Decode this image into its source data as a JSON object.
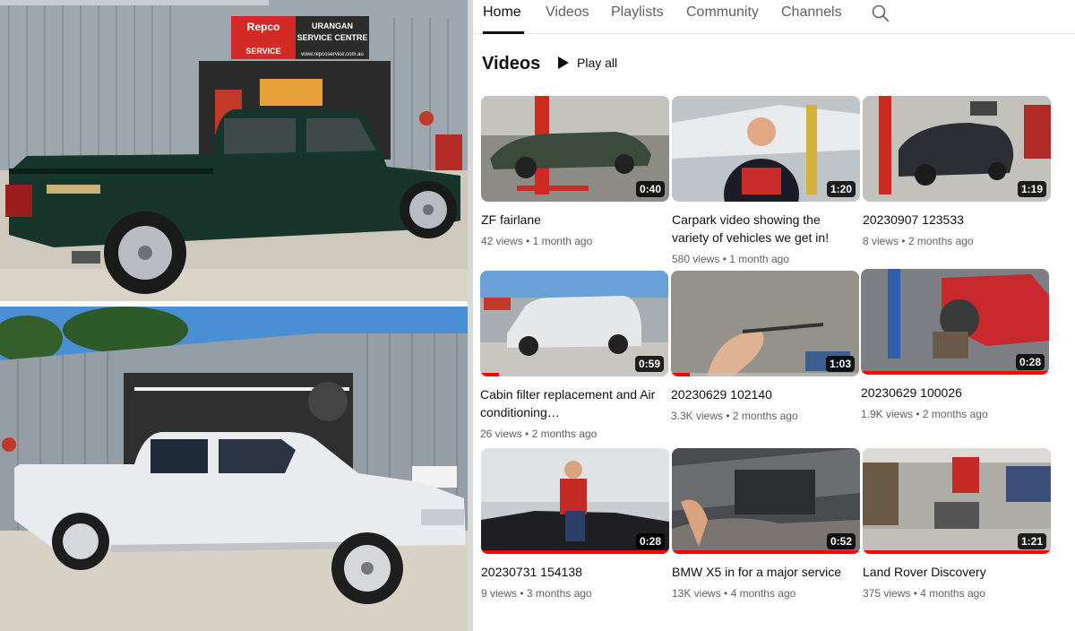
{
  "tabs": [
    {
      "label": "Home"
    },
    {
      "label": "Videos"
    },
    {
      "label": "Playlists"
    },
    {
      "label": "Community"
    },
    {
      "label": "Channels"
    }
  ],
  "search_icon": "search-icon",
  "section": {
    "title": "Videos",
    "play_all": "Play all"
  },
  "shop_sign": {
    "brand": "Repco",
    "line1": "URANGAN",
    "line2": "SERVICE CENTRE",
    "service": "SERVICE",
    "url": "www.repcoservice.com.au"
  },
  "videos": [
    {
      "title": "ZF fairlane",
      "views": "42 views",
      "age": "1 month ago",
      "duration": "0:40",
      "progress": 0
    },
    {
      "title": "Carpark video showing the variety of vehicles we get in!",
      "views": "580 views",
      "age": "1 month ago",
      "duration": "1:20",
      "progress": 0
    },
    {
      "title": "20230907 123533",
      "views": "8 views",
      "age": "2 months ago",
      "duration": "1:19",
      "progress": 0
    },
    {
      "title": "Cabin filter replacement and Air conditioning…",
      "views": "26 views",
      "age": "2 months ago",
      "duration": "0:59",
      "progress": 0.1
    },
    {
      "title": "20230629 102140",
      "views": "3.3K views",
      "age": "2 months ago",
      "duration": "1:03",
      "progress": 0.1
    },
    {
      "title": "20230629 100026",
      "views": "1.9K views",
      "age": "2 months ago",
      "duration": "0:28",
      "progress": 1.0
    },
    {
      "title": "20230731 154138",
      "views": "9 views",
      "age": "3 months ago",
      "duration": "0:28",
      "progress": 1.0
    },
    {
      "title": "BMW X5 in for a major service",
      "views": "13K views",
      "age": "4 months ago",
      "duration": "0:52",
      "progress": 1.0
    },
    {
      "title": "Land Rover Discovery",
      "views": "375 views",
      "age": "4 months ago",
      "duration": "1:21",
      "progress": 1.0
    }
  ],
  "colors": {
    "accent_red": "#ff0000",
    "text_primary": "#0f0f0f",
    "text_secondary": "#606060"
  }
}
